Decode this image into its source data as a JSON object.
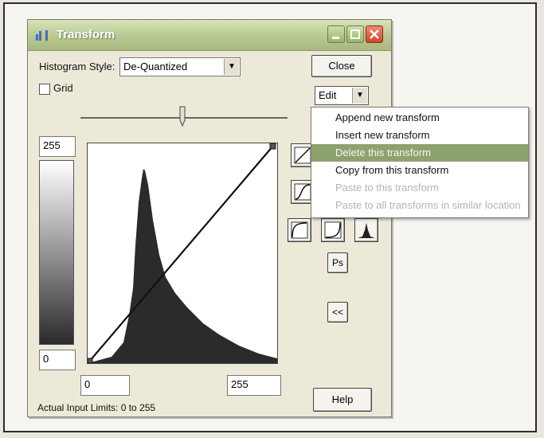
{
  "window": {
    "title": "Transform"
  },
  "controls": {
    "histogram_style_label": "Histogram Style:",
    "histogram_style_value": "De-Quantized",
    "grid_label": "Grid",
    "close_label": "Close",
    "edit_label": "Edit",
    "help_label": "Help",
    "ps_label": "Ps",
    "collapse_label": "<<"
  },
  "levels": {
    "output_max": "255",
    "output_min": "0",
    "input_min": "0",
    "input_max": "255",
    "actual_input_limits": "Actual Input Limits: 0 to 255"
  },
  "edit_menu": {
    "items": [
      {
        "label": "Append new transform",
        "state": "normal"
      },
      {
        "label": "Insert new transform",
        "state": "normal"
      },
      {
        "label": "Delete this transform",
        "state": "selected"
      },
      {
        "label": "Copy from this transform",
        "state": "normal"
      },
      {
        "label": "Paste to this transform",
        "state": "disabled"
      },
      {
        "label": "Paste to all transforms in similar location",
        "state": "disabled"
      }
    ]
  },
  "tool_icons": [
    "linear-curve-icon",
    "s-curve-icon",
    "concave-curve-icon",
    "convex-curve-icon",
    "histogram-peak-icon"
  ],
  "colors": {
    "titlebar": "#b8c893",
    "menu_selection": "#8ea26e"
  }
}
